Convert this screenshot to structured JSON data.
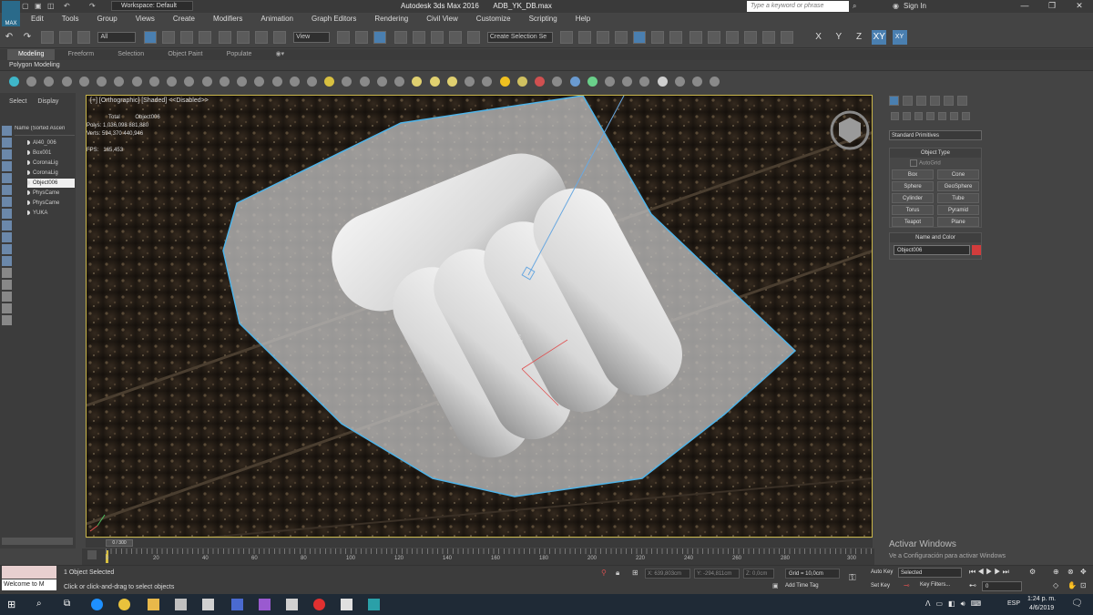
{
  "app": {
    "title": "Autodesk 3ds Max 2016",
    "filename": "ADB_YK_DB.max",
    "logo_text": "MAX",
    "workspace": "Workspace: Default",
    "search_placeholder": "Type a keyword or phrase",
    "sign_in": "Sign In",
    "window_minimize": "—",
    "window_restore": "❐",
    "window_close": "✕"
  },
  "menu": [
    "Edit",
    "Tools",
    "Group",
    "Views",
    "Create",
    "Modifiers",
    "Animation",
    "Graph Editors",
    "Rendering",
    "Civil View",
    "Customize",
    "Scripting",
    "Help"
  ],
  "toolbar": {
    "filter": "All",
    "ref_coord": "View",
    "selection_set": "Create Selection Se",
    "axes": [
      "X",
      "Y",
      "Z",
      "XY",
      "XY"
    ]
  },
  "ribbon": {
    "tabs": [
      "Modeling",
      "Freeform",
      "Selection",
      "Object Paint",
      "Populate"
    ],
    "active": "Modeling",
    "subpanel": "Polygon Modeling"
  },
  "explorer": {
    "tabs": [
      "Select",
      "Display"
    ],
    "header": "Name (Sorted Ascen",
    "items": [
      "AI40_006",
      "Box001",
      "CoronaLig",
      "CoronaLig",
      "Object006",
      "PhysCame",
      "PhysCame",
      "YUKA"
    ],
    "selected_index": 4
  },
  "viewport": {
    "label": "[+] [Orthographic] [Shaded] <<Disabled>>",
    "stats": {
      "col_total": "Total",
      "col_object": "Object006",
      "polys_label": "Polys:",
      "polys_total": "1,036,098",
      "polys_object": "881,880",
      "verts_label": "Verts:",
      "verts_total": "594,370",
      "verts_object": "440,946",
      "fps_label": "FPS:",
      "fps_value": "165,453"
    },
    "gizmo": {
      "x": "x",
      "y": "y",
      "z": "z"
    }
  },
  "command_panel": {
    "dropdown": "Standard Primitives",
    "object_type_title": "Object Type",
    "autogrid": "AutoGrid",
    "buttons": [
      "Box",
      "Cone",
      "Sphere",
      "GeoSphere",
      "Cylinder",
      "Tube",
      "Torus",
      "Pyramid",
      "Teapot",
      "Plane"
    ],
    "name_color_title": "Name and Color",
    "object_name": "Object006",
    "object_color": "#d23c3c"
  },
  "timeline": {
    "slider": "0 / 300",
    "ticks": [
      "0",
      "20",
      "40",
      "60",
      "80",
      "100",
      "120",
      "140",
      "160",
      "180",
      "200",
      "220",
      "240",
      "260",
      "280",
      "300"
    ]
  },
  "watermark": {
    "line1": "Activar Windows",
    "line2": "Ve a Configuración para activar Windows"
  },
  "status": {
    "maxscript": "Welcome to M",
    "selection": "1 Object Selected",
    "prompt": "Click or click-and-drag to select objects",
    "x": "X: 639,803cm",
    "y": "Y: -294,811cm",
    "z": "Z: 0,0cm",
    "grid": "Grid = 10,0cm",
    "add_time_tag": "Add Time Tag",
    "auto_key": "Auto Key",
    "set_key": "Set Key",
    "selected": "Selected",
    "key_filters": "Key Filters...",
    "frame": "0"
  },
  "taskbar": {
    "lang": "ESP",
    "time": "1:24 p. m.",
    "date": "4/6/2019"
  },
  "colors": {
    "accent": "#4a7fb0",
    "viewport_border": "#c9b64a",
    "selection_outline": "#4fb3e8"
  }
}
